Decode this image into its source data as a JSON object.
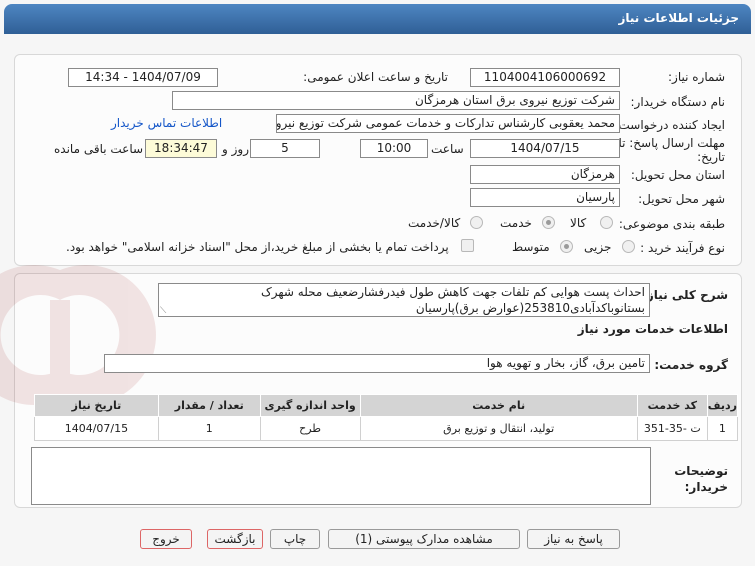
{
  "header": {
    "title": "جزئیات اطلاعات نیاز"
  },
  "fields": {
    "need_number_label": "شماره نیاز:",
    "need_number": "1104004106000692",
    "announce_label": "تاریخ و ساعت اعلان عمومی:",
    "announce_value": "1404/07/09 - 14:34",
    "buyer_org_label": "نام دستگاه خریدار:",
    "buyer_org": "شرکت توزیع نیروی برق استان هرمزگان",
    "creator_label": "ایجاد کننده درخواست:",
    "creator": "محمد یعقوبی کارشناس تدارکات و خدمات عمومی شرکت توزیع نیروی برق استان",
    "contact_link": "اطلاعات تماس خریدار",
    "deadline_label_1": "مهلت ارسال پاسخ: تا",
    "deadline_label_2": "تاریخ:",
    "deadline_date": "1404/07/15",
    "time_label": "ساعت",
    "deadline_time": "10:00",
    "days": "5",
    "days_label": "روز و",
    "remaining_time": "18:34:47",
    "remaining_label": "ساعت باقی مانده",
    "province_label": "استان محل تحویل:",
    "province": "هرمزگان",
    "city_label": "شهر محل تحویل:",
    "city": "پارسیان",
    "category_label": "طبقه بندی موضوعی:",
    "category_options": [
      "کالا",
      "خدمت",
      "کالا/خدمت"
    ],
    "category_selected": "خدمت",
    "process_label": "نوع فرآیند خرید :",
    "process_options": [
      "جزیی",
      "متوسط"
    ],
    "process_selected": "متوسط",
    "payment_text": "پرداخت تمام یا بخشی از مبلغ خرید،از محل \"اسناد خزانه اسلامی\" خواهد بود."
  },
  "description": {
    "label": "شرح کلی نیاز:",
    "text": "احداث پست هوایی کم تلفات جهت کاهش طول فیدرفشارضعیف محله شهرک بستانوباکدآبادی253810(عوارض برق)پارسیان"
  },
  "services": {
    "section_title": "اطلاعات خدمات مورد نیاز",
    "group_label": "گروه خدمت:",
    "group_value": "تامین برق، گاز، بخار و تهویه هوا",
    "table": {
      "headers": [
        "ردیف",
        "کد خدمت",
        "نام خدمت",
        "واحد اندازه گیری",
        "تعداد / مقدار",
        "تاریخ نیاز"
      ],
      "rows": [
        [
          "1",
          "ت -35-351",
          "تولید، انتقال و توزیع برق",
          "طرح",
          "1",
          "1404/07/15"
        ]
      ]
    }
  },
  "buyer_notes": {
    "label_1": "توضیحات",
    "label_2": "خریدار:",
    "value": ""
  },
  "buttons": {
    "reply": "پاسخ به نیاز",
    "attachments": "مشاهده مدارک پیوستی (1)",
    "print": "چاپ",
    "back": "بازگشت",
    "exit": "خروج"
  },
  "watermark": {
    "text": "AriaTender.net"
  },
  "colors": {
    "title_bar": "#3a6ea8",
    "link": "#1456c8",
    "remaining_bg": "#fdfbd8"
  }
}
